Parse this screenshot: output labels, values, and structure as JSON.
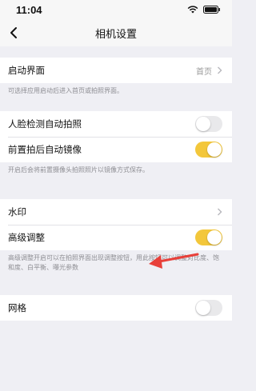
{
  "status": {
    "time": "11:04"
  },
  "header": {
    "title": "相机设置"
  },
  "launch": {
    "label": "启动界面",
    "value": "首页",
    "hint": "可选择应用启动后进入首页或拍照界面。"
  },
  "face": {
    "label": "人脸检测自动拍照",
    "on": false
  },
  "mirror": {
    "label": "前置拍后自动镜像",
    "on": true,
    "hint": "开启后会将前置摄像头拍照照片以镜像方式保存。"
  },
  "watermark": {
    "label": "水印"
  },
  "advanced": {
    "label": "高级调整",
    "on": true,
    "hint": "高级调整开启可以在拍照界面出现调整按钮，用此按钮可以调整对比度、饱和度、白平衡、曝光参数"
  },
  "grid": {
    "label": "网格",
    "on": false
  },
  "colors": {
    "toggle_on": "#f3c73b",
    "toggle_off": "#e9e9eb",
    "arrow": "#e8403a"
  }
}
